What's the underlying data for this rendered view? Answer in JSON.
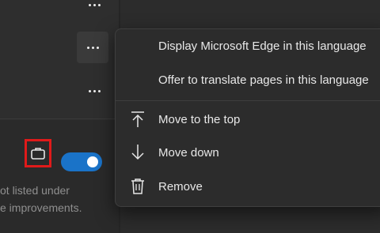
{
  "panel": {
    "description_line1": "ot listed under",
    "description_line2": "e improvements."
  },
  "icons": {
    "more": "more-horizontal-icon",
    "briefcase": "briefcase-icon",
    "move_top": "arrow-up-to-line-icon",
    "move_down": "arrow-down-icon",
    "remove": "trash-icon"
  },
  "toggle": {
    "state": "on",
    "color": "#1a73c8"
  },
  "highlight_color": "#e01a1a",
  "menu": {
    "items": [
      {
        "label": "Display Microsoft Edge in this language"
      },
      {
        "label": "Offer to translate pages in this language"
      },
      {
        "label": "Move to the top"
      },
      {
        "label": "Move down"
      },
      {
        "label": "Remove"
      }
    ]
  }
}
